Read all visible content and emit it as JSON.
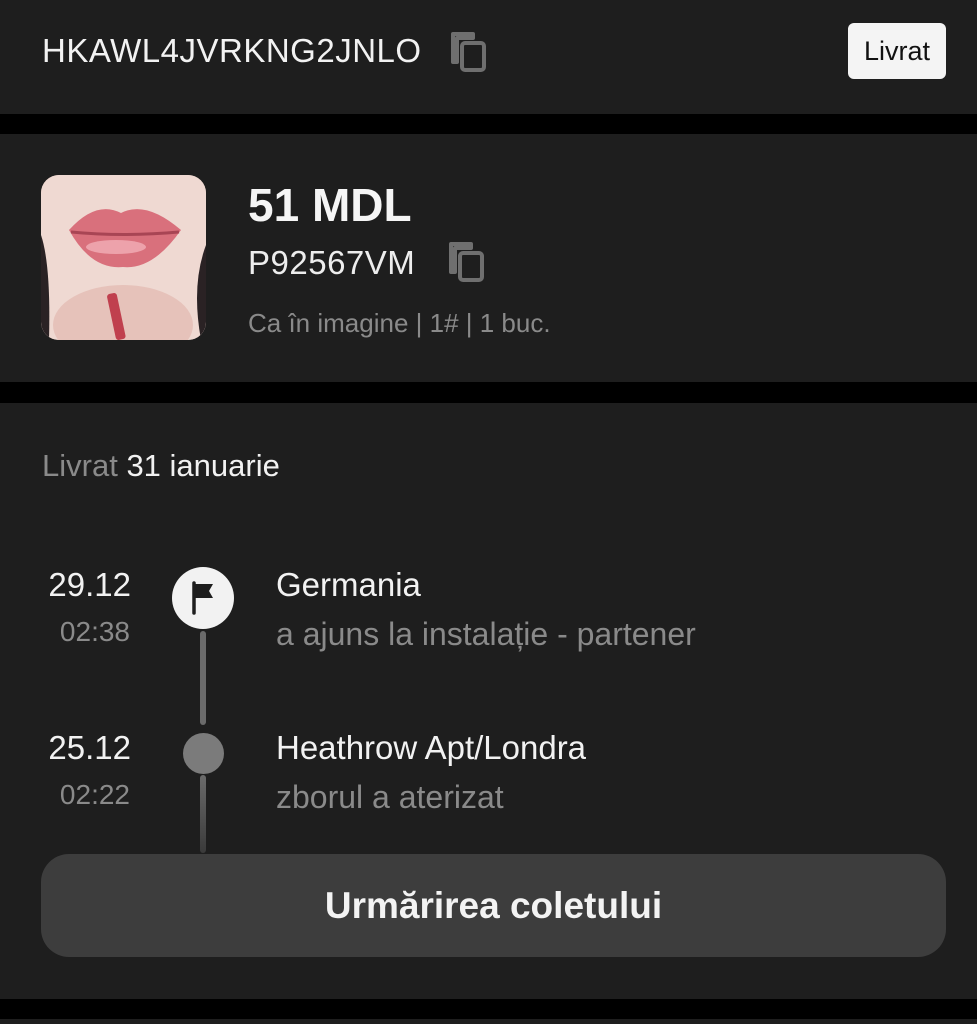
{
  "order": {
    "id": "HKAWL4JVRKNG2JNLO",
    "status": "Livrat",
    "copy_icon": "copy-icon"
  },
  "product": {
    "price": "51 MDL",
    "sku": "P92567VM",
    "variant": "Ca în imagine | 1# | 1 buc.",
    "copy_icon": "copy-icon"
  },
  "tracking": {
    "delivered_label": "Livrat",
    "delivered_date": "31 ianuarie",
    "events": [
      {
        "date": "29.12",
        "time": "02:38",
        "location": "Germania",
        "description": "a ajuns la instalație - partener",
        "icon": "flag-icon"
      },
      {
        "date": "25.12",
        "time": "02:22",
        "location": "Heathrow Apt/Londra",
        "description": "zborul a aterizat",
        "icon": "dot-icon"
      }
    ],
    "button_label": "Urmărirea coletului"
  },
  "colors": {
    "background": "#000000",
    "card": "#1e1e1e",
    "muted_text": "#8a8a8a",
    "button": "#3d3d3d",
    "badge": "#f4f4f4"
  }
}
